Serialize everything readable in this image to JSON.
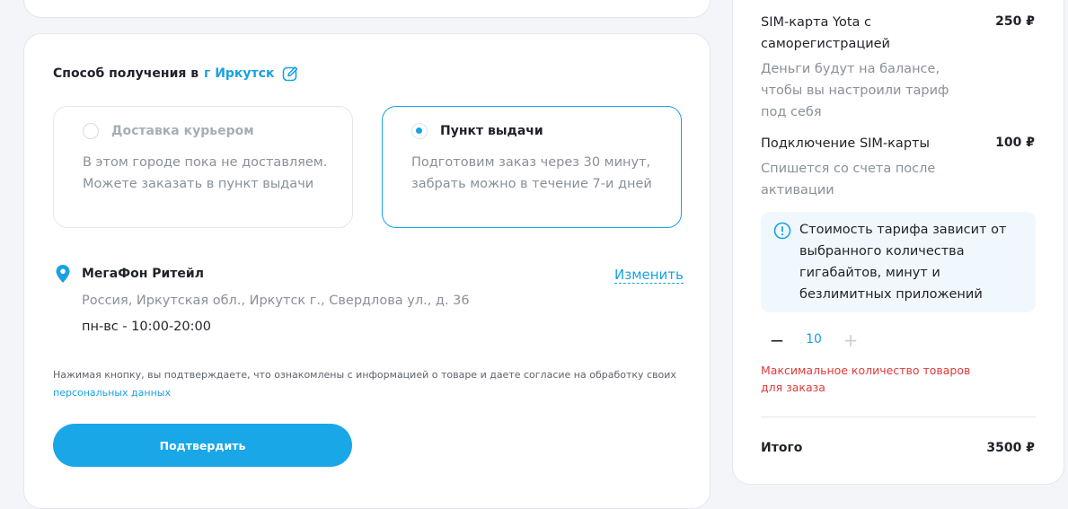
{
  "delivery": {
    "title": "Способ получения в",
    "city": "г Иркутск",
    "options": [
      {
        "title": "Доставка курьером",
        "description": "В этом городе пока не доставляем. Можете заказать в пункт выдачи",
        "selected": false,
        "disabled": true
      },
      {
        "title": "Пункт выдачи",
        "description": "Подготовим заказ через 30 минут, забрать можно в течение 7-и дней",
        "selected": true,
        "disabled": false
      }
    ]
  },
  "pickup_point": {
    "name": "МегаФон Ритейл",
    "change_label": "Изменить",
    "address": "Россия, Иркутская обл., Иркутск г., Свердлова ул., д. 36",
    "hours": "пн-вс - 10:00-20:00"
  },
  "consent": {
    "text": "Нажимая кнопку, вы подтверждаете, что ознакомлены с информацией о товаре и даете согласие на обработку своих",
    "link": "персональных данных"
  },
  "confirm_label": "Подтвердить",
  "summary": {
    "items": [
      {
        "name": "SIM-карта Yota с саморегистрацией",
        "price": "250 ₽",
        "note": "Деньги будут на балансе, чтобы вы настроили тариф под себя"
      },
      {
        "name": "Подключение SIM-карты",
        "price": "100 ₽",
        "note": "Спишется со счета после активации"
      }
    ],
    "info": "Стоимость тарифа зависит от выбранного количества гигабайтов, минут и безлимитных приложений",
    "quantity": "10",
    "minus_symbol": "−",
    "plus_symbol": "+",
    "warning": "Максимальное количество товаров для заказа",
    "total_label": "Итого",
    "total_value": "3500 ₽"
  },
  "colors": {
    "accent": "#1aa1e2",
    "button": "#1aa7e8",
    "warning": "#e03a3a",
    "info_bg": "#f1f8fd"
  }
}
